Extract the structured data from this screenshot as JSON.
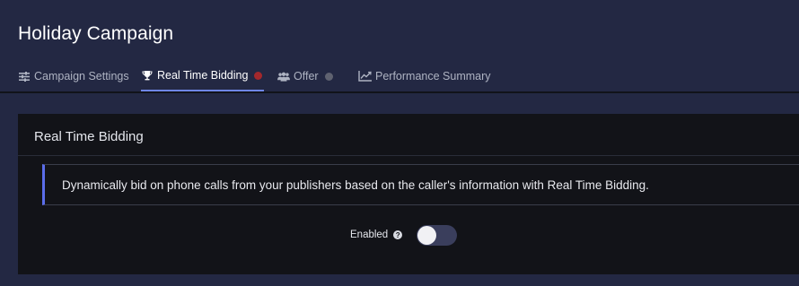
{
  "page": {
    "title": "Holiday Campaign"
  },
  "tabs": [
    {
      "label": "Campaign Settings",
      "icon": "sliders-icon",
      "active": false
    },
    {
      "label": "Real Time Bidding",
      "icon": "trophy-icon",
      "active": true,
      "status_color": "#a3282c"
    },
    {
      "label": "Offer",
      "icon": "users-icon",
      "active": false,
      "status_color": "#5f6270"
    },
    {
      "label": "Performance Summary",
      "icon": "line-chart-icon",
      "active": false
    }
  ],
  "card": {
    "title": "Real Time Bidding",
    "description": "Dynamically bid on phone calls from your publishers based on the caller's information with Real Time Bidding.",
    "toggle": {
      "label": "Enabled",
      "help_glyph": "?",
      "enabled": false
    }
  },
  "colors": {
    "background": "#232843",
    "card": "#121318",
    "accent": "#5b6dea",
    "active_tab_underline": "#6f86e6"
  }
}
